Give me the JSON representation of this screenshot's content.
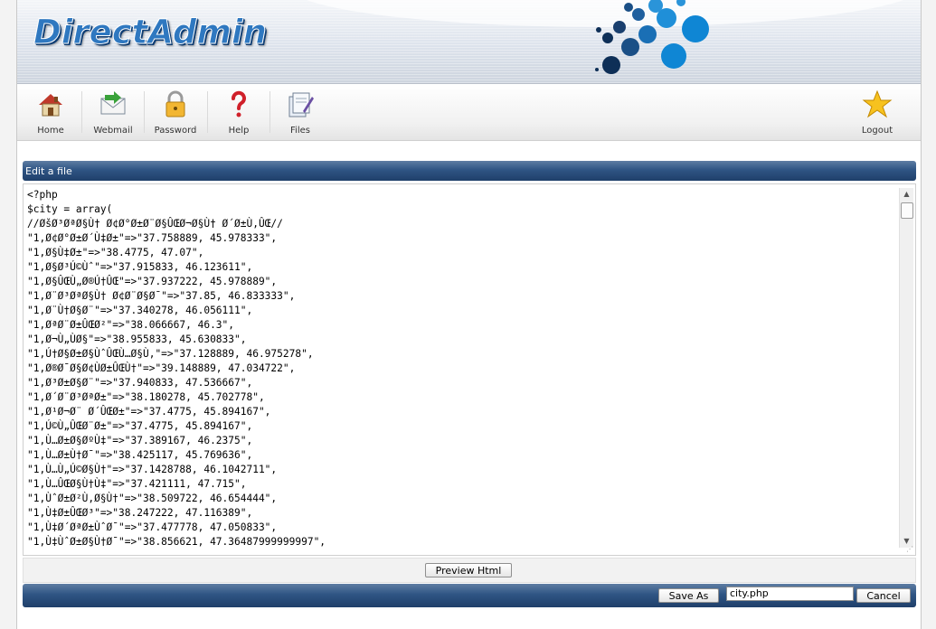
{
  "header": {
    "brand": "DirectAdmin"
  },
  "toolbar": {
    "items": [
      {
        "label": "Home",
        "icon": "house-icon"
      },
      {
        "label": "Webmail",
        "icon": "envelope-icon"
      },
      {
        "label": "Password",
        "icon": "padlock-icon"
      },
      {
        "label": "Help",
        "icon": "question-mark-icon"
      },
      {
        "label": "Files",
        "icon": "files-icon"
      }
    ],
    "logout": {
      "label": "Logout",
      "icon": "star-icon"
    }
  },
  "panel": {
    "title": "Edit a file"
  },
  "editor": {
    "content": "<?php\n$city = array(\n//ØšØ³ØªØ§Ù† Ø¢Ø°Ø±Ø¨Ø§ÛŒØ¬Ø§Ù† Ø´Ø±Ù‚ÛŒ//\n\"1,Ø¢Ø°Ø±Ø´Ù‡Ø±\"=>\"37.758889, 45.978333\",\n\"1,Ø§Ù‡Ø±\"=>\"38.4775, 47.07\",\n\"1,Ø§Ø³Ú©Ùˆ\"=>\"37.915833, 46.123611\",\n\"1,Ø§ÛŒÙ„Ø®Ú†ÛŒ\"=>\"37.937222, 45.978889\",\n\"1,Ø¨Ø³ØªØ§Ù† Ø¢Ø¨Ø§Ø¯\"=>\"37.85, 46.833333\",\n\"1,Ø¨Ù†Ø§Ø¨\"=>\"37.340278, 46.056111\",\n\"1,ØªØ¨Ø±ÛŒØ²\"=>\"38.066667, 46.3\",\n\"1,Ø¬Ù„ÙØ§\"=>\"38.955833, 45.630833\",\n\"1,Ú†Ø§Ø±Ø§ÙˆÛŒÙ…Ø§Ù‚\"=>\"37.128889, 46.975278\",\n\"1,Ø®Ø¯Ø§Ø¢ÙØ±ÛŒÙ†\"=>\"39.148889, 47.034722\",\n\"1,Ø³Ø±Ø§Ø¨\"=>\"37.940833, 47.536667\",\n\"1,Ø´Ø¨Ø³ØªØ±\"=>\"38.180278, 45.702778\",\n\"1,Ø¹Ø¬Ø¨ Ø´ÛŒØ±\"=>\"37.4775, 45.894167\",\n\"1,Ú©Ù„ÛŒØ¨Ø±\"=>\"37.4775, 45.894167\",\n\"1,Ù…Ø±Ø§ØºÙ‡\"=>\"37.389167, 46.2375\",\n\"1,Ù…Ø±Ù†Ø¯\"=>\"38.425117, 45.769636\",\n\"1,Ù…Ù„Ú©Ø§Ù†\"=>\"37.1428788, 46.1042711\",\n\"1,Ù…ÛŒØ§Ù†Ù‡\"=>\"37.421111, 47.715\",\n\"1,ÙˆØ±Ø²Ù‚Ø§Ù†\"=>\"38.509722, 46.654444\",\n\"1,Ù‡Ø±ÛŒØ³\"=>\"38.247222, 47.116389\",\n\"1,Ù‡Ø´ØªØ±ÙˆØ¯\"=>\"37.477778, 47.050833\",\n\"1,Ù‡ÙˆØ±Ø§Ù†Ø¯\"=>\"38.856621, 47.36487999999997\","
  },
  "actions": {
    "preview_label": "Preview Html",
    "save_as_label": "Save As",
    "filename_value": "city.php",
    "cancel_label": "Cancel"
  },
  "colors": {
    "brand_blue": "#2f78c0",
    "bar_navy": "#2f5584"
  }
}
